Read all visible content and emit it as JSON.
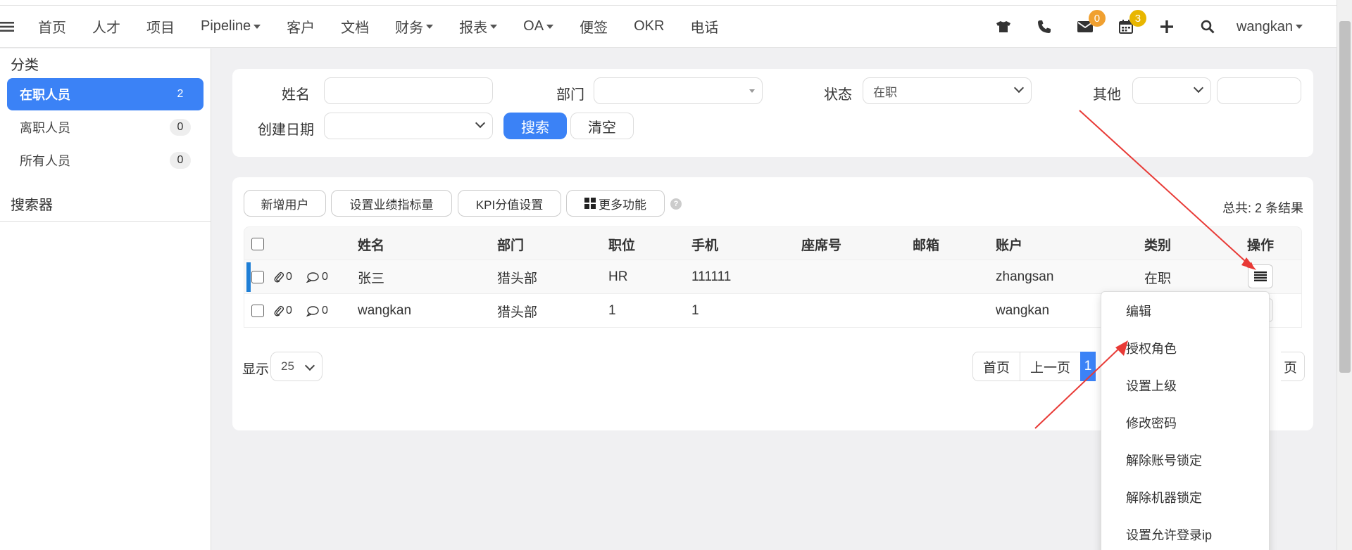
{
  "nav": {
    "items": [
      {
        "label": "首页",
        "caret": false
      },
      {
        "label": "人才",
        "caret": false
      },
      {
        "label": "项目",
        "caret": false
      },
      {
        "label": "Pipeline",
        "caret": true
      },
      {
        "label": "客户",
        "caret": false
      },
      {
        "label": "文档",
        "caret": false
      },
      {
        "label": "财务",
        "caret": true
      },
      {
        "label": "报表",
        "caret": true
      },
      {
        "label": "OA",
        "caret": true
      },
      {
        "label": "便签",
        "caret": false
      },
      {
        "label": "OKR",
        "caret": false
      },
      {
        "label": "电话",
        "caret": false
      }
    ],
    "mail_badge": "0",
    "calendar_badge": "3",
    "user": "wangkan",
    "colors": {
      "mail_badge": "#f0a030",
      "calendar_badge": "#e8b600"
    }
  },
  "sidebar": {
    "category_heading": "分类",
    "items": [
      {
        "label": "在职人员",
        "count": "2"
      },
      {
        "label": "离职人员",
        "count": "0"
      },
      {
        "label": "所有人员",
        "count": "0"
      }
    ],
    "search_heading": "搜索器"
  },
  "filter": {
    "name_label": "姓名",
    "name_value": "",
    "dept_label": "部门",
    "dept_value": "",
    "status_label": "状态",
    "status_value": "在职",
    "other_label": "其他",
    "other_select_value": "",
    "other_input_value": "",
    "created_label": "创建日期",
    "created_value": "",
    "search_button": "搜索",
    "clear_button": "清空"
  },
  "toolbar": {
    "add_user": "新增用户",
    "set_metric": "设置业绩指标量",
    "kpi_setting": "KPI分值设置",
    "more": "更多功能",
    "total": "总共: 2 条结果"
  },
  "table": {
    "headers": {
      "name": "姓名",
      "dept": "部门",
      "position": "职位",
      "phone": "手机",
      "seat": "座席号",
      "email": "邮箱",
      "account": "账户",
      "type": "类别",
      "action": "操作"
    },
    "rows": [
      {
        "attach": "0",
        "comment": "0",
        "name": "张三",
        "dept": "猎头部",
        "position": "HR",
        "phone": "111111",
        "seat": "",
        "email": "",
        "account": "zhangsan",
        "type": "在职"
      },
      {
        "attach": "0",
        "comment": "0",
        "name": "wangkan",
        "dept": "猎头部",
        "position": "1",
        "phone": "1",
        "seat": "",
        "email": "",
        "account": "wangkan",
        "type": ""
      }
    ]
  },
  "pager": {
    "show_label": "显示",
    "page_size": "25",
    "first": "首页",
    "prev": "上一页",
    "current": "1",
    "tail": "页"
  },
  "action_menu": {
    "items": [
      "编辑",
      "授权角色",
      "设置上级",
      "修改密码",
      "解除账号锁定",
      "解除机器锁定",
      "设置允许登录ip"
    ]
  },
  "colors": {
    "primary": "#3b82f6",
    "annotation_arrow": "#e83a36"
  }
}
